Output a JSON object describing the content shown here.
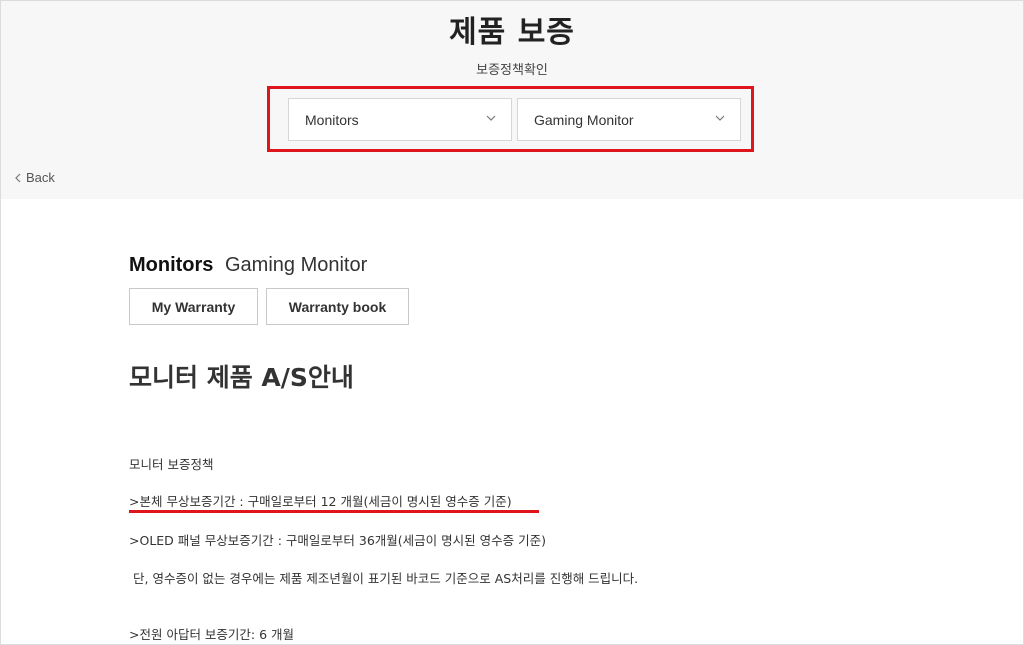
{
  "header": {
    "title": "제품 보증",
    "subtitle": "보증정책확인"
  },
  "selectors": {
    "category": {
      "value": "Monitors"
    },
    "type": {
      "value": "Gaming Monitor"
    }
  },
  "nav": {
    "back_label": "Back"
  },
  "product": {
    "category": "Monitors",
    "type": "Gaming Monitor"
  },
  "buttons": {
    "my_warranty": "My Warranty",
    "warranty_book": "Warranty book"
  },
  "section": {
    "title": "모니터 제품 A/S안내",
    "policy_heading": "모니터 보증정책",
    "body_warranty": ">본체 무상보증기간 : 구매일로부터 12 개월(세금이 명시된 영수증 기준)",
    "oled_warranty": ">OLED 패널 무상보증기간 : 구매일로부터 36개월(세금이 명시된 영수증 기준)",
    "note": "단, 영수증이 없는 경우에는 제품 제조년월이 표기된 바코드 기준으로 AS처리를 진행해 드립니다.",
    "adapter_warranty": ">전원 아답터 보증기간: 6 개월"
  },
  "colors": {
    "highlight": "#e0141b",
    "header_bg": "#f7f7f7"
  },
  "icons": {
    "select_chevron": "chevron-down-icon",
    "back": "chevron-left-icon"
  }
}
